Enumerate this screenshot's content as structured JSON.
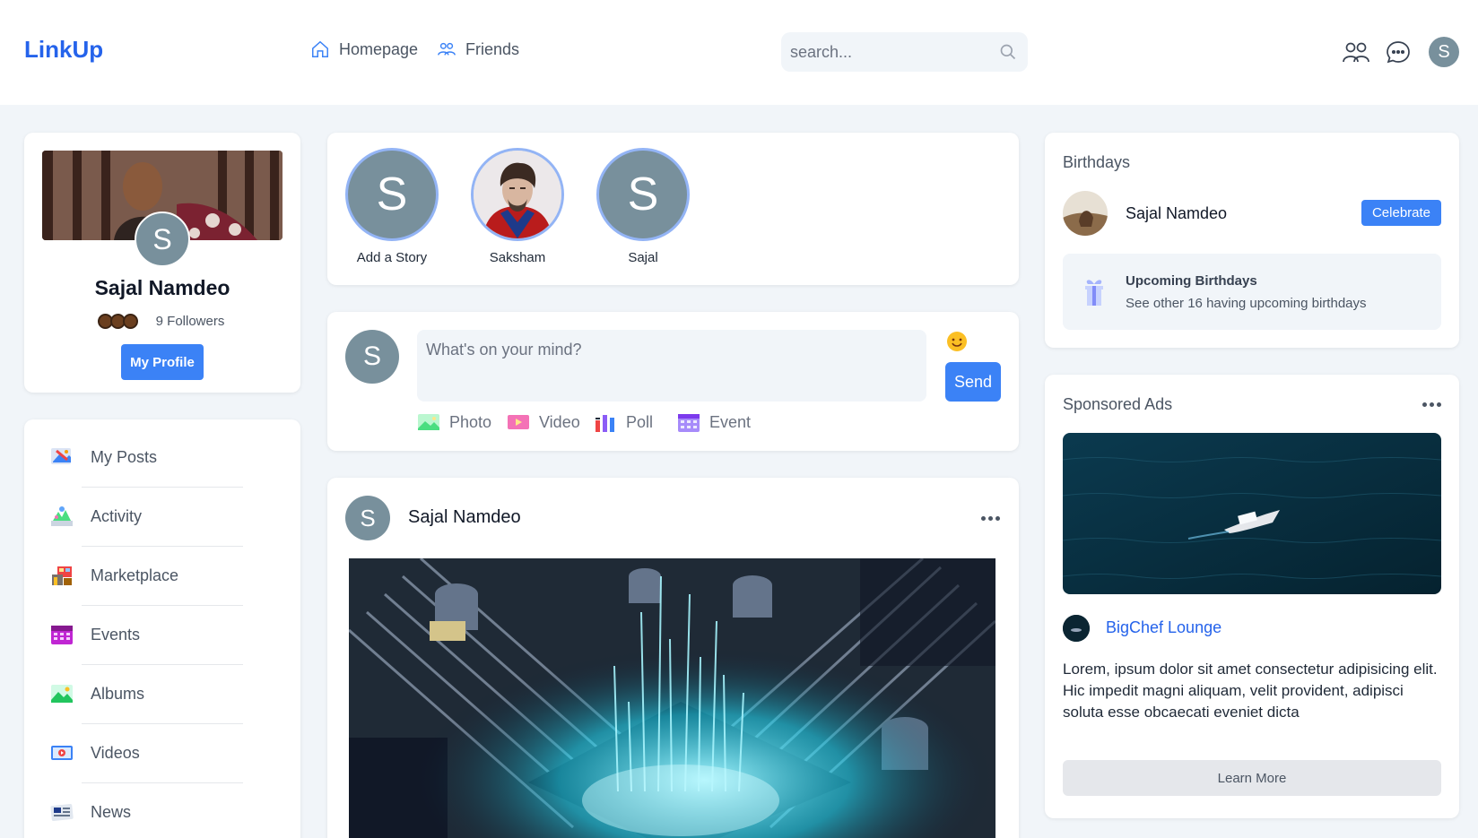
{
  "header": {
    "logo": "LinkUp",
    "nav": [
      {
        "label": "Homepage",
        "icon": "home-icon"
      },
      {
        "label": "Friends",
        "icon": "friends-icon"
      }
    ],
    "search": {
      "placeholder": "search...",
      "value": ""
    },
    "user_avatar_letter": "S"
  },
  "profile": {
    "name": "Sajal Namdeo",
    "avatar_letter": "S",
    "followers_text": "9 Followers",
    "button_label": "My Profile"
  },
  "menu": {
    "items": [
      {
        "label": "My Posts",
        "icon": "my-posts-icon"
      },
      {
        "label": "Activity",
        "icon": "activity-icon"
      },
      {
        "label": "Marketplace",
        "icon": "marketplace-icon"
      },
      {
        "label": "Events",
        "icon": "events-icon"
      },
      {
        "label": "Albums",
        "icon": "albums-icon"
      },
      {
        "label": "Videos",
        "icon": "videos-icon"
      },
      {
        "label": "News",
        "icon": "news-icon"
      }
    ]
  },
  "stories": [
    {
      "label": "Add a Story",
      "letter": "S"
    },
    {
      "label": "Saksham",
      "letter": ""
    },
    {
      "label": "Sajal",
      "letter": "S"
    }
  ],
  "composer": {
    "avatar_letter": "S",
    "placeholder": "What's on your mind?",
    "value": "",
    "send_label": "Send",
    "attachments": [
      {
        "label": "Photo",
        "icon": "photo-icon"
      },
      {
        "label": "Video",
        "icon": "video-icon"
      },
      {
        "label": "Poll",
        "icon": "poll-icon"
      },
      {
        "label": "Event",
        "icon": "event-icon"
      }
    ]
  },
  "post": {
    "avatar_letter": "S",
    "author": "Sajal Namdeo"
  },
  "birthdays": {
    "title": "Birthdays",
    "name": "Sajal Namdeo",
    "celebrate_label": "Celebrate",
    "upcoming_title": "Upcoming Birthdays",
    "upcoming_text": "See other 16 having upcoming birthdays"
  },
  "ads": {
    "title": "Sponsored Ads",
    "brand": "BigChef Lounge",
    "description": "Lorem, ipsum dolor sit amet consectetur adipisicing elit. Hic impedit magni aliquam, velit provident, adipisci soluta esse obcaecati eveniet dicta",
    "button_label": "Learn More"
  },
  "colors": {
    "accent": "#3b82f6",
    "logo": "#2563eb",
    "avatar": "#78909c",
    "background": "#f1f5f9"
  }
}
